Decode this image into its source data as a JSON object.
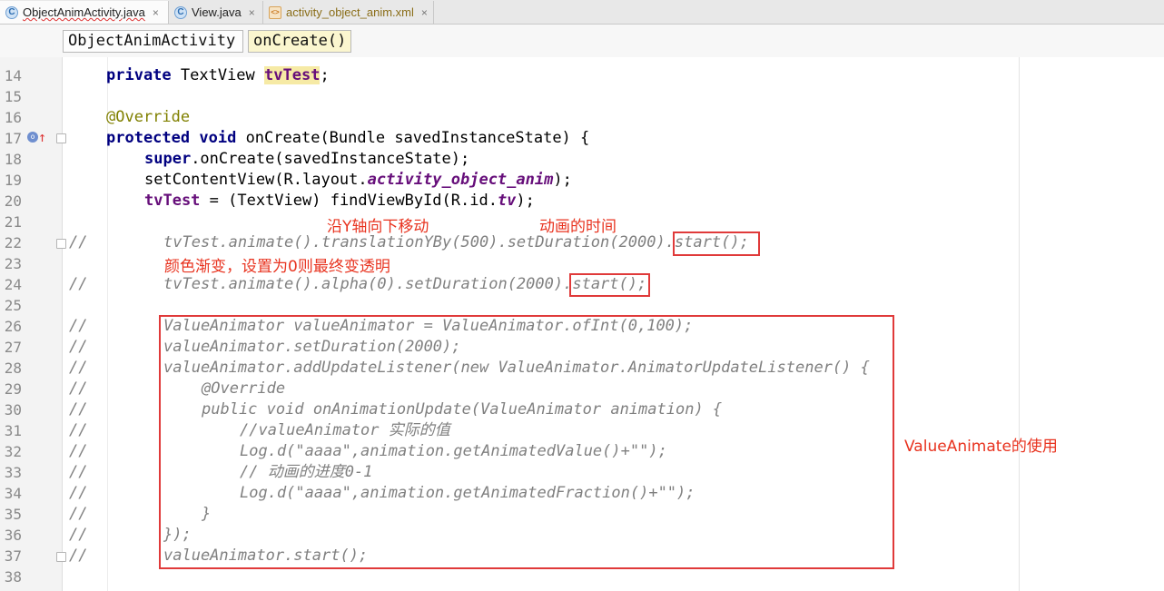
{
  "tabs": [
    {
      "name": "ObjectAnimActivity.java",
      "icon": "class-file-icon",
      "active": true
    },
    {
      "name": "View.java",
      "icon": "class-file-icon",
      "active": false
    },
    {
      "name": "activity_object_anim.xml",
      "icon": "xml-file-icon",
      "active": false
    }
  ],
  "tab_close_glyph": "×",
  "breadcrumb": {
    "class_name": "ObjectAnimActivity",
    "method_name": "onCreate()"
  },
  "lines": {
    "l14": {
      "num": "14",
      "kw": "private",
      "type": " TextView ",
      "field": "tvTest",
      "tail": ";"
    },
    "l15": {
      "num": "15"
    },
    "l16": {
      "num": "16",
      "annotation": "@Override"
    },
    "l17": {
      "num": "17",
      "kw1": "protected",
      "kw2": "void",
      "text": " onCreate(Bundle savedInstanceState) {"
    },
    "l18": {
      "num": "18",
      "kw": "super",
      "text": ".onCreate(savedInstanceState);"
    },
    "l19": {
      "num": "19",
      "pre": "setContentView(R.layout.",
      "field": "activity_object_anim",
      "post": ");"
    },
    "l20": {
      "num": "20",
      "field1": "tvTest",
      "pre": " = (TextView) findViewById(R.id.",
      "field2": "tv",
      "post": ");"
    },
    "l21": {
      "num": "21"
    },
    "l22": {
      "num": "22",
      "slash": "//",
      "text": "tvTest.animate().translationYBy(500).setDuration(2000)",
      "boxed": ".start();"
    },
    "l23": {
      "num": "23"
    },
    "l24": {
      "num": "24",
      "slash": "//",
      "text": "tvTest.animate().alpha(0).setDuration(2000)",
      "boxed": ".start()",
      "tail": ";"
    },
    "l25": {
      "num": "25"
    },
    "l26": {
      "num": "26",
      "slash": "//",
      "text": "ValueAnimator valueAnimator = ValueAnimator.ofInt(0,100);"
    },
    "l27": {
      "num": "27",
      "slash": "//",
      "text": "valueAnimator.setDuration(2000);"
    },
    "l28": {
      "num": "28",
      "slash": "//",
      "text": "valueAnimator.addUpdateListener(new ValueAnimator.AnimatorUpdateListener() {"
    },
    "l29": {
      "num": "29",
      "slash": "//",
      "text": "@Override"
    },
    "l30": {
      "num": "30",
      "slash": "//",
      "text": "public void onAnimationUpdate(ValueAnimator animation) {"
    },
    "l31": {
      "num": "31",
      "slash": "//",
      "text": "//valueAnimator 实际的值"
    },
    "l32": {
      "num": "32",
      "slash": "//",
      "text": "Log.d(\"aaaa\",animation.getAnimatedValue()+\"\");"
    },
    "l33": {
      "num": "33",
      "slash": "//",
      "text": "// 动画的进度0-1"
    },
    "l34": {
      "num": "34",
      "slash": "//",
      "text": "Log.d(\"aaaa\",animation.getAnimatedFraction()+\"\");"
    },
    "l35": {
      "num": "35",
      "slash": "//",
      "text": "}"
    },
    "l36": {
      "num": "36",
      "slash": "//",
      "text": "});"
    },
    "l37": {
      "num": "37",
      "slash": "//",
      "text": "valueAnimator.start();"
    },
    "l38": {
      "num": "38"
    }
  },
  "annotations": {
    "move_y": "沿Y轴向下移动",
    "anim_time": "动画的时间",
    "color_fade": "颜色渐变，设置为0则最终变透明",
    "value_animate": "ValueAnimate的使用"
  },
  "colors": {
    "annotation_red": "#e8331f",
    "keyword": "#000080",
    "field": "#660e7a",
    "comment": "#808080"
  }
}
